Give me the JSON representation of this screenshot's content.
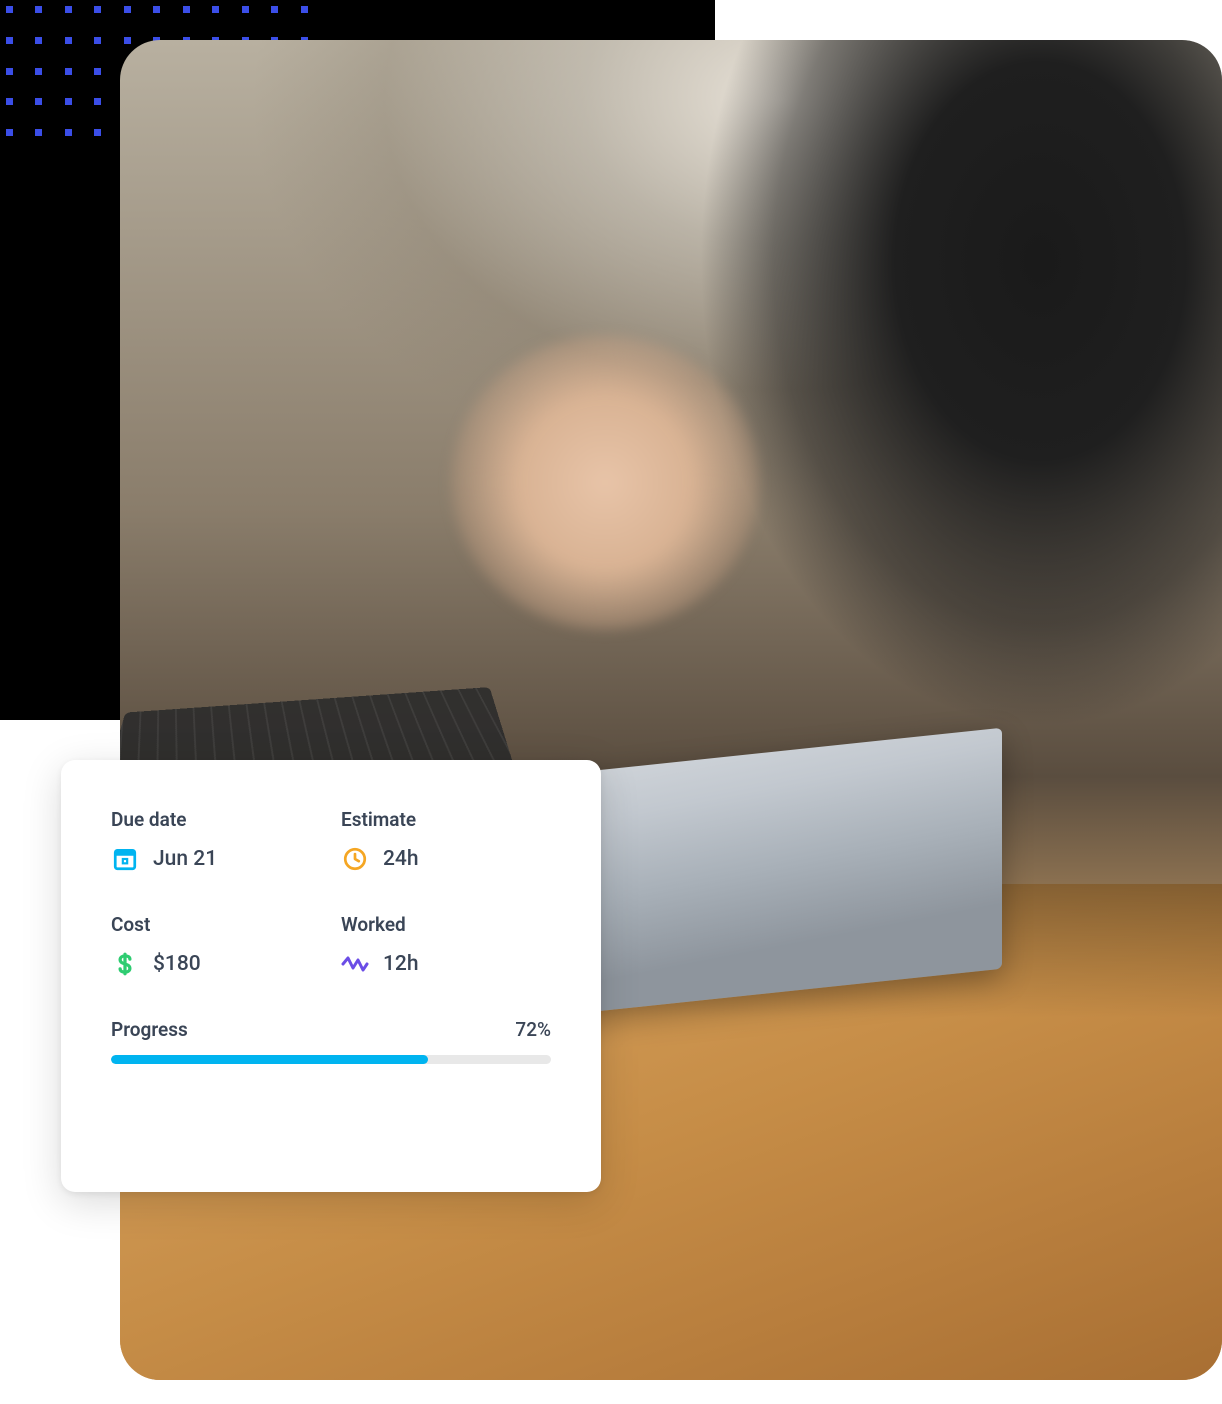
{
  "card": {
    "due_date": {
      "label": "Due date",
      "value": "Jun 21",
      "icon_color": "#00b4f0"
    },
    "estimate": {
      "label": "Estimate",
      "value": "24h",
      "icon_color": "#f5a623"
    },
    "cost": {
      "label": "Cost",
      "value": "$180",
      "icon_color": "#2ecc71"
    },
    "worked": {
      "label": "Worked",
      "value": "12h",
      "icon_color": "#6b4de6"
    },
    "progress": {
      "label": "Progress",
      "percent_text": "72%",
      "percent": 72,
      "fill_color": "#00b4f0"
    }
  }
}
